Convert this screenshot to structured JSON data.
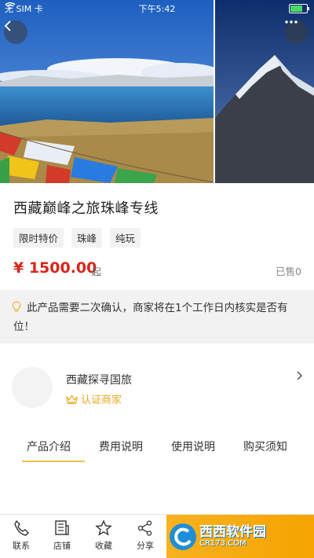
{
  "status_bar": {
    "carrier": "无 SIM 卡",
    "time": "下午5:42",
    "battery_level": 0.7
  },
  "hero": {
    "back_icon": "chevron-left-icon",
    "more_icon": "more-dots-icon"
  },
  "product": {
    "title": "西藏巅峰之旅珠峰专线",
    "tags": [
      "限时特价",
      "珠峰",
      "纯玩"
    ],
    "price": "¥ 1500.00",
    "price_suffix": "起",
    "sold": "已售0"
  },
  "notice": {
    "icon": "lightbulb-icon",
    "text": "此产品需要二次确认，商家将在1个工作日内核实是否有位！"
  },
  "merchant": {
    "name": "西藏探寻国旅",
    "cert_label": "认证商家",
    "cert_icon": "crown-icon"
  },
  "tabs": [
    {
      "label": "产品介绍",
      "active": true
    },
    {
      "label": "费用说明",
      "active": false
    },
    {
      "label": "使用说明",
      "active": false
    },
    {
      "label": "购买须知",
      "active": false
    }
  ],
  "bottom_bar": {
    "items": [
      {
        "label": "联系",
        "icon": "phone-icon"
      },
      {
        "label": "店铺",
        "icon": "store-icon"
      },
      {
        "label": "收藏",
        "icon": "star-icon"
      },
      {
        "label": "分享",
        "icon": "share-icon"
      }
    ],
    "watermark": {
      "main": "西西软件园",
      "sub": "CR173.COM"
    }
  },
  "colors": {
    "price": "#d9261c",
    "accent_gold": "#e8a81c",
    "tab_underline": "#f2c24e",
    "cta": "#f5a400"
  }
}
